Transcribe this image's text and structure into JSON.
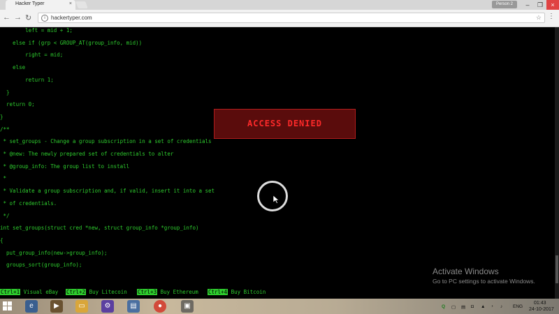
{
  "browser": {
    "tab_title": "Hacker Typer",
    "tab_close": "×",
    "profile": "Person 2",
    "url": "hackertyper.com",
    "window_controls": {
      "minimize": "–",
      "restore": "❐",
      "close": "×"
    }
  },
  "code_lines": [
    "        left = mid + 1;",
    "    else if (grp < GROUP_AT(group_info, mid))",
    "        right = mid;",
    "    else",
    "        return 1;",
    "  }",
    "  return 0;",
    "}",
    "/**",
    " * set_groups - Change a group subscription in a set of credentials",
    " * @new: The newly prepared set of credentials to alter",
    " * @group_info: The group list to install",
    " *",
    " * Validate a group subscription and, if valid, insert it into a set",
    " * of credentials.",
    " */",
    "int set_groups(struct cred *new, struct group_info *group_info)",
    "{",
    "  put_group_info(new->group_info);",
    "  groups_sort(group_info);"
  ],
  "alert": {
    "text": "ACCESS DENIED"
  },
  "watermark": {
    "title": "Activate Windows",
    "subtitle": "Go to PC settings to activate Windows."
  },
  "footer": [
    {
      "key": "Ctrl+1",
      "label": " Visual eBay"
    },
    {
      "key": "Ctrl+2",
      "label": " Buy Litecoin"
    },
    {
      "key": "Ctrl+3",
      "label": " Buy Ethereum"
    },
    {
      "key": "Ctrl+4",
      "label": " Buy Bitcoin"
    }
  ],
  "taskbar": {
    "language": "ENG",
    "time": "01:43",
    "date": "24-10-2017"
  },
  "colors": {
    "code_green": "#2ecc2e",
    "alert_red": "#ff2a2a",
    "alert_bg": "#5a0c0c"
  }
}
